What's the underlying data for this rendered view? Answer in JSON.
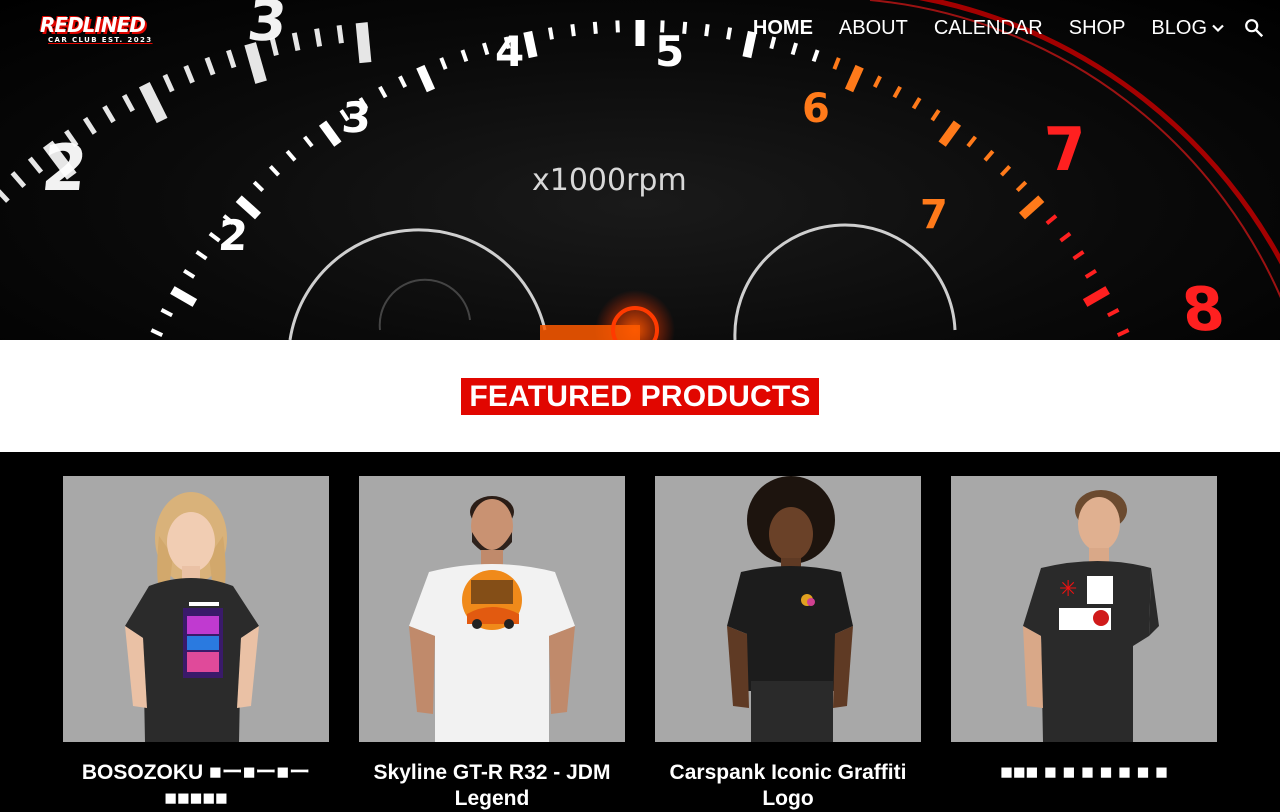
{
  "site": {
    "logo_text": "REDLINED",
    "logo_subtext": "CAR CLUB EST. 2023"
  },
  "nav": {
    "items": [
      {
        "label": "HOME",
        "active": true
      },
      {
        "label": "ABOUT",
        "active": false
      },
      {
        "label": "CALENDAR",
        "active": false
      },
      {
        "label": "SHOP",
        "active": false
      },
      {
        "label": "BLOG",
        "active": false,
        "has_dropdown": true
      }
    ],
    "search_icon": "search-icon"
  },
  "hero": {
    "gauge_label": "x1000rpm",
    "gauge_numbers": [
      "2",
      "3",
      "4",
      "5",
      "6",
      "7",
      "3",
      "2",
      "7"
    ]
  },
  "featured": {
    "heading": "FEATURED PRODUCTS"
  },
  "products": [
    {
      "title": "BOSOZOKU ■ー■ー■ー■■■■■",
      "shirt_color": "#2b2b2b",
      "model": "woman-blonde"
    },
    {
      "title": "Skyline GT-R R32 - JDM Legend",
      "shirt_color": "#f2f2f2",
      "model": "man-beard"
    },
    {
      "title": "Carspank Iconic Graffiti Logo",
      "shirt_color": "#1c1c1c",
      "model": "woman-curly"
    },
    {
      "title": "■■■ ■ ■ ■ ■ ■ ■ ■",
      "shirt_color": "#2a2a2a",
      "model": "man-short"
    }
  ],
  "colors": {
    "accent_red": "#e10600",
    "product_bg": "#a8a8a8"
  }
}
